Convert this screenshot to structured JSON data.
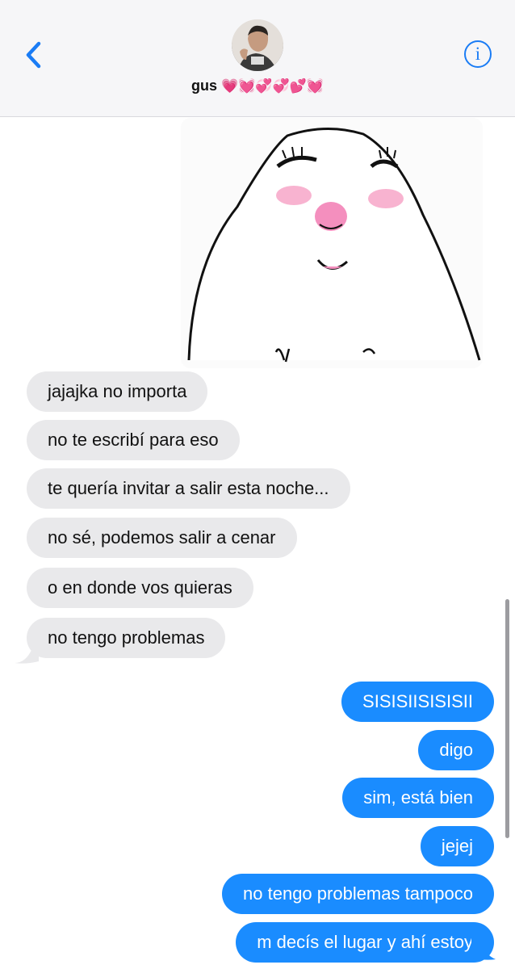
{
  "contact": {
    "name": "gus",
    "hearts": "💗💓💞💞💕💓"
  },
  "colors": {
    "accent": "#1a7cf5",
    "incoming_bubble": "#e9e9eb",
    "outgoing_bubble": "#1a8cff"
  },
  "icons": {
    "back": "chevron-left-icon",
    "info": "info-icon"
  },
  "info_glyph": "i",
  "messages_in": [
    "jajajka no importa",
    "no te escribí para eso",
    "te quería invitar a salir esta noche...",
    "no sé, podemos salir a cenar",
    "o en donde vos quieras",
    "no tengo problemas"
  ],
  "messages_out": [
    "SISISIISISISII",
    "digo",
    "sim, está bien",
    "jejej",
    "no tengo problemas tampoco",
    "m decís el lugar y ahí estoy"
  ]
}
